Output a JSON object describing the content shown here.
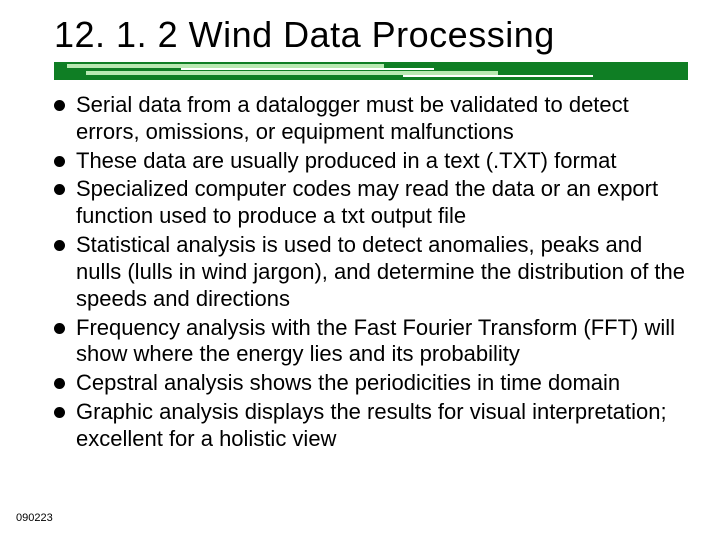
{
  "title": "12. 1. 2 Wind Data Processing",
  "bullets": [
    "Serial data from a datalogger must be validated to detect errors, omissions, or equipment malfunctions",
    "These data are usually produced in a text (.TXT) format",
    "Specialized computer codes may read the data or an export function used to produce a txt output file",
    "Statistical analysis is used to detect anomalies, peaks and nulls (lulls in wind jargon), and determine the distribution of the speeds and directions",
    "Frequency analysis with the Fast Fourier Transform (FFT) will show where the energy lies and its probability",
    "Cepstral analysis shows the periodicities in time domain",
    "Graphic analysis displays the results for visual interpretation; excellent for a holistic view"
  ],
  "footer": "090223"
}
